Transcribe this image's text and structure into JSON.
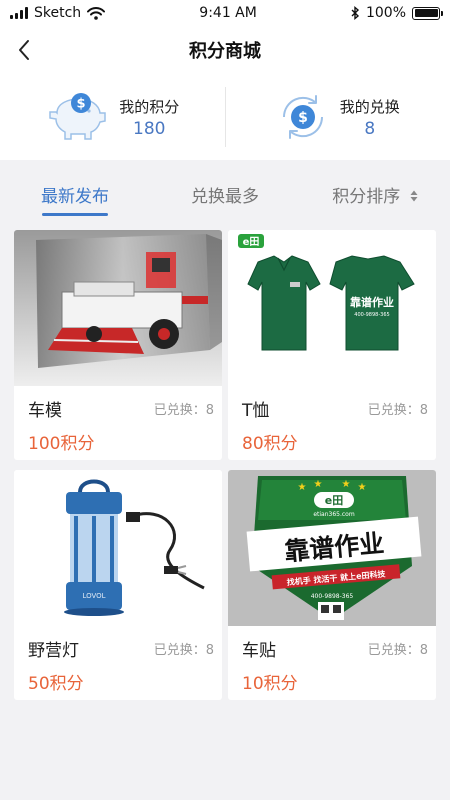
{
  "status": {
    "carrier": "Sketch",
    "time": "9:41 AM",
    "battery": "100%",
    "battery_level": 1.0
  },
  "nav": {
    "title": "积分商城"
  },
  "summary": {
    "points_label": "我的积分",
    "points_value": "180",
    "exchange_label": "我的兑换",
    "exchange_value": "8"
  },
  "tabs": [
    {
      "label": "最新发布"
    },
    {
      "label": "兑换最多"
    },
    {
      "label": "积分排序"
    }
  ],
  "products": [
    {
      "name": "车模",
      "exchanged": "已兑换：8",
      "points": "100积分"
    },
    {
      "name": "T恤",
      "exchanged": "已兑换：8",
      "points": "80积分",
      "logo": "e田",
      "back_text": "靠谱作业",
      "back_sub": "400-9898-365"
    },
    {
      "name": "野营灯",
      "exchanged": "已兑换：8",
      "points": "50积分",
      "brand": "LOVOL"
    },
    {
      "name": "车贴",
      "exchanged": "已兑换：8",
      "points": "10积分",
      "site": "etian365.com",
      "slogan": "靠谱作业",
      "tagline": "找机手 找活干 就上e田科技",
      "phone": "400-9898-365"
    }
  ],
  "colors": {
    "accent": "#3d78c9",
    "points": "#e8643a",
    "value": "#4a78c2"
  }
}
